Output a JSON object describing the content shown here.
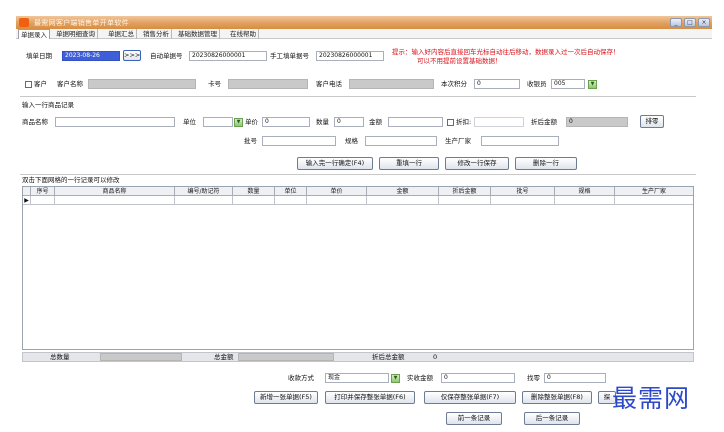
{
  "window": {
    "title": "最需网客户端销售单开单软件"
  },
  "tabs": [
    "单据录入",
    "单据明细查询",
    "单据汇总",
    "销售分析",
    "基础数据管理",
    "在线帮助"
  ],
  "header": {
    "date_label": "填单日期",
    "date_value": "2023-08-26",
    "jump_label": ">>>",
    "auto_no_label": "自动单据号",
    "auto_no_value": "20230826000001",
    "manual_no_label": "手工填单据号",
    "manual_no_value": "20230826000001",
    "hint_line1": "提示：输入好内容后直接回车光标自动往后移动，数据录入过一次后自动保存！",
    "hint_line2": "可以不用提前设置基础数据！",
    "customer_chk_label": "客户",
    "customer_name_label": "客户名称",
    "card_label": "卡号",
    "phone_label": "客户电话",
    "points_label": "本次积分",
    "points_value": "0",
    "cashier_label": "收银员",
    "cashier_value": "005"
  },
  "entry": {
    "section_title": "输入一行商品记录",
    "product_label": "商品名称",
    "unit_label": "单位",
    "price_label": "单价",
    "price_value": "0",
    "qty_label": "数量",
    "qty_value": "0",
    "amount_label": "金额",
    "discount_label": "折扣:",
    "discount_amount_label": "折后金额",
    "discount_amount_value": "0",
    "reset_button": "排零",
    "batch_label": "批号",
    "spec_label": "规格",
    "maker_label": "生产厂家",
    "confirm_button": "输入完一行确定(F4)",
    "refill_button": "重填一行",
    "modify_button": "修改一行保存",
    "delete_button": "删除一行"
  },
  "grid": {
    "caption": "双击下面网格的一行记录可以修改",
    "columns": [
      "序号",
      "商品名称",
      "编号/助记符",
      "数量",
      "单位",
      "单价",
      "金额",
      "折后金额",
      "批号",
      "规格",
      "生产厂家"
    ],
    "row_marker": "▶"
  },
  "totals": {
    "qty_label": "总数量",
    "amount_label": "总金额",
    "discount_total_label": "折后总金额",
    "discount_total_value": "0"
  },
  "footer": {
    "payment_label": "收款方式",
    "payment_value": "现金",
    "paid_label": "实收金额",
    "paid_value": "0",
    "change_label": "找零",
    "change_value": "0",
    "new_button": "新增一张单据(F5)",
    "print_save_button": "打印并保存整张单据(F6)",
    "save_button": "仅保存整张单据(F7)",
    "delete_button": "删除整张单据(F8)",
    "extra_button": "探",
    "prev_button": "前一条记录",
    "next_button": "后一条记录"
  },
  "watermark": "最需网",
  "colors": {
    "titlebar": "#e09a58",
    "hint_red": "#d8121a",
    "date_selected": "#3f5fd8",
    "watermark_blue": "#2e49c8"
  }
}
